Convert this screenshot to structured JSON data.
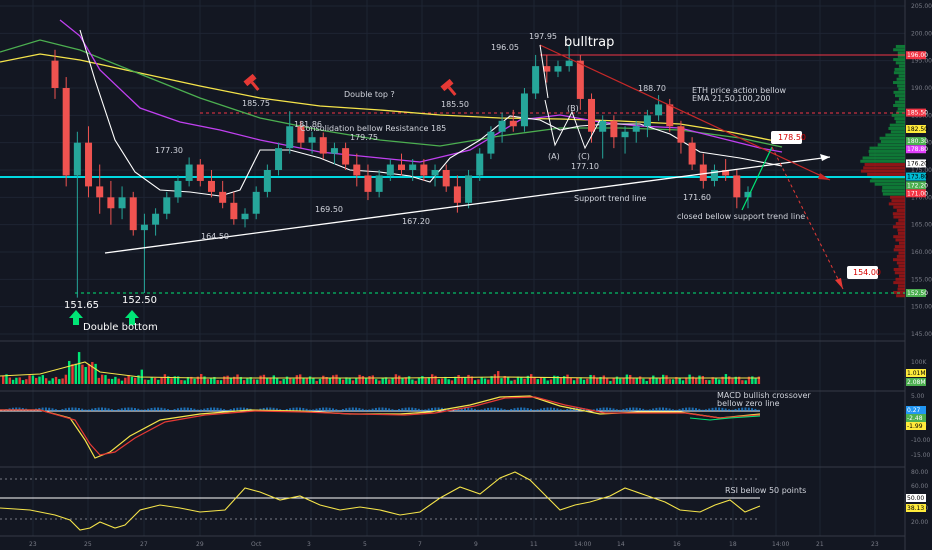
{
  "chart_data": {
    "type": "candlestick",
    "price_axis": {
      "min": 140,
      "max": 206,
      "ticks": [
        205.0,
        200.0,
        195.0,
        190.0,
        185.0,
        180.0,
        175.0,
        170.0,
        165.0,
        160.0,
        155.0,
        150.0,
        145.0
      ]
    },
    "date_axis": {
      "ticks": [
        "23",
        "25",
        "27",
        "29",
        "Oct",
        "3",
        "5",
        "7",
        "9",
        "11",
        "14:00",
        "14",
        "16",
        "18",
        "14:00",
        "21",
        "23"
      ]
    },
    "volume_axis": {
      "ticks": [
        "100K"
      ]
    },
    "macd_axis": {
      "ticks": [
        "5.00",
        "-5.00",
        "-10.00",
        "-15.00"
      ]
    },
    "rsi_axis": {
      "ticks": [
        "80.00",
        "60.00",
        "40.00",
        "20.00"
      ]
    },
    "right_tags": [
      {
        "value": 196.0,
        "label": "196.00",
        "color": "#f23645"
      },
      {
        "value": 185.5,
        "label": "185.50",
        "color": "#f23645"
      },
      {
        "value": 182.5,
        "label": "182.50",
        "color": "#ffeb3b"
      },
      {
        "value": 180.3,
        "label": "180.30",
        "color": "#4caf50"
      },
      {
        "value": 178.8,
        "label": "178.80",
        "color": "#e040fb"
      },
      {
        "value": 176.2,
        "label": "176.20",
        "color": "#ffffff"
      },
      {
        "value": 173.8,
        "label": "173.80",
        "color": "#00bcd4"
      },
      {
        "value": 172.2,
        "label": "172.20",
        "color": "#4caf50"
      },
      {
        "value": 171.0,
        "label": "171.00",
        "color": "#f23645"
      },
      {
        "value": 152.5,
        "label": "152.50",
        "color": "#4caf50"
      }
    ],
    "volume_tags": [
      {
        "label": "1.01M",
        "color": "#ffeb3b"
      },
      {
        "label": "2.08M",
        "color": "#4caf50"
      }
    ],
    "macd_tags": [
      {
        "label": "0.27",
        "color": "#2196f3"
      },
      {
        "label": "-2.48",
        "color": "#4caf50"
      },
      {
        "label": "-1.99",
        "color": "#ffeb3b"
      }
    ],
    "rsi_tags": [
      {
        "label": "50.00",
        "color": "#ffffff"
      },
      {
        "label": "38.13",
        "color": "#ffeb3b"
      }
    ],
    "annotations": {
      "low_151": "151.65",
      "low_152": "152.50",
      "double_bottom": "Double bottom",
      "p177_30": "177.30",
      "p164_50": "164.50",
      "p185_75": "185.75",
      "p181_86": "181.86",
      "consolidation": "Consolidation bellow Resistance 185",
      "p179_75": "179.75",
      "double_top": "Double top ?",
      "p169_50": "169.50",
      "p185_50": "185.50",
      "p167_20": "167.20",
      "p196_05": "196.05",
      "p197_95": "197.95",
      "bulltrap": "bulltrap",
      "wave_a": "(A)",
      "wave_b": "(B)",
      "wave_c": "(C)",
      "p177_10": "177.10",
      "p188_70": "188.70",
      "eth_note_1": "ETH price action bellow",
      "eth_note_2": "EMA 21,50,100,200",
      "target_178": "178.50",
      "target_154": "154.00",
      "p171_60": "171.60",
      "support_line": "Support trend line",
      "closed_bellow": "closed bellow support trend line",
      "macd_note_1": "MACD bullish crossover",
      "macd_note_2": "bellow zero line",
      "rsi_note": "RSI bellow 50 points"
    },
    "candles_ohlc": [
      [
        195,
        197,
        188,
        190
      ],
      [
        190,
        192,
        172,
        174
      ],
      [
        174,
        182,
        151.65,
        180
      ],
      [
        180,
        183,
        170,
        172
      ],
      [
        172,
        176,
        167,
        170
      ],
      [
        170,
        173,
        165,
        168
      ],
      [
        168,
        172,
        166,
        170
      ],
      [
        170,
        171,
        163,
        164
      ],
      [
        164,
        167,
        152.5,
        165
      ],
      [
        165,
        168,
        163,
        167
      ],
      [
        167,
        171,
        166,
        170
      ],
      [
        170,
        174,
        169,
        173
      ],
      [
        173,
        177.3,
        172,
        176
      ],
      [
        176,
        177,
        172,
        173
      ],
      [
        173,
        175,
        170,
        171
      ],
      [
        171,
        173,
        168,
        169
      ],
      [
        169,
        171,
        165,
        166
      ],
      [
        166,
        168,
        164.5,
        167
      ],
      [
        167,
        172,
        166,
        171
      ],
      [
        171,
        176,
        170,
        175
      ],
      [
        175,
        180,
        174,
        179
      ],
      [
        179,
        185.75,
        178,
        183
      ],
      [
        183,
        184,
        179,
        180
      ],
      [
        180,
        182,
        178,
        181
      ],
      [
        181,
        181.86,
        177,
        178
      ],
      [
        178,
        180,
        176,
        179
      ],
      [
        179,
        180,
        175,
        176
      ],
      [
        176,
        178,
        172,
        174
      ],
      [
        174,
        176,
        169.5,
        171
      ],
      [
        171,
        175,
        170,
        174
      ],
      [
        174,
        177,
        173,
        176
      ],
      [
        176,
        178,
        174,
        175
      ],
      [
        175,
        177,
        173,
        176
      ],
      [
        176,
        177,
        173,
        174
      ],
      [
        174,
        176,
        172,
        175
      ],
      [
        175,
        176,
        171,
        172
      ],
      [
        172,
        174,
        167.2,
        169
      ],
      [
        169,
        175,
        168,
        174
      ],
      [
        174,
        179,
        173,
        178
      ],
      [
        178,
        183,
        177,
        182
      ],
      [
        182,
        185.5,
        180,
        184
      ],
      [
        184,
        186,
        182,
        183
      ],
      [
        183,
        190,
        182,
        189
      ],
      [
        189,
        196.05,
        188,
        194
      ],
      [
        194,
        196,
        191,
        193
      ],
      [
        193,
        195,
        192,
        194
      ],
      [
        194,
        197.95,
        193,
        195
      ],
      [
        195,
        196,
        186,
        188
      ],
      [
        188,
        189,
        180,
        182
      ],
      [
        182,
        185,
        177.1,
        184
      ],
      [
        184,
        185,
        179,
        181
      ],
      [
        181,
        183,
        178,
        182
      ],
      [
        182,
        184,
        180,
        183
      ],
      [
        183,
        186,
        181,
        185
      ],
      [
        185,
        188.7,
        184,
        187
      ],
      [
        187,
        188,
        182,
        183
      ],
      [
        183,
        184,
        178,
        180
      ],
      [
        180,
        181,
        175,
        176
      ],
      [
        176,
        178,
        171.6,
        173
      ],
      [
        173,
        176,
        172,
        175
      ],
      [
        175,
        177,
        173,
        174
      ],
      [
        174,
        175,
        168,
        170
      ],
      [
        170,
        172,
        168,
        171
      ]
    ]
  }
}
